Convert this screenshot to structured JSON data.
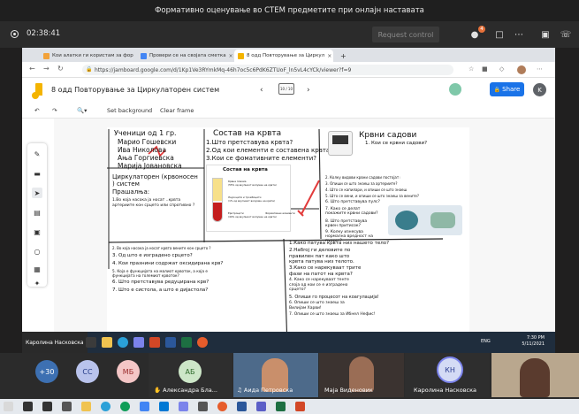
{
  "meeting": {
    "title": "Формативно оценување во СТЕМ предметите при онлајн наставата",
    "timer": "02:38:41",
    "request_control": "Request control",
    "participants_badge": "4"
  },
  "browser": {
    "tabs": [
      {
        "label": "Кои алатки ги користам за фор",
        "color": "#f2a23a"
      },
      {
        "label": "Провери се на својата сметка",
        "color": "#4285f4"
      },
      {
        "label": "8 одд Повторување за Циркул",
        "color": "#f4b400"
      }
    ],
    "url": "https://jamboard.google.com/d/1Kp1Ve3RYmkMq-46h7oc5c6PdK6ZTUoF_ln5vL4cYCk/viewer?f=9"
  },
  "jamboard": {
    "title": "8 одд Повторување за Циркулаторен систем",
    "share_label": "Share",
    "user_initial": "K",
    "frame_label": "10 / 10",
    "tools": {
      "set_background": "Set background",
      "clear_frame": "Clear frame"
    }
  },
  "board": {
    "students_header": "Ученици од 1 гр.",
    "students": [
      "Марио Гошевски",
      "Ива Николова",
      "Ања Горгиевска",
      "Марија Јовановска"
    ],
    "blood_title": "Состав на крвта",
    "blood_questions": [
      "1.Што претставува крвта?",
      "2.Од кои елементи е составена крвта?",
      "3.Кои се фомативните елементи?"
    ],
    "blood_diagram_title": "Состав на крвта",
    "blood_diagram_labels": [
      "Крвна плазма",
      "(55% од вкупниот волумен на крвта)",
      "Леукоцити и тромбоцити",
      "(1% од вкупниот волумен на крвта)",
      "Еритроцити",
      "(44% од вкупниот волумен на крвта)",
      "Формативни елементи"
    ],
    "vessels_title": "Крвни садови",
    "vessels_q1": "1. Кои се крвни садови?",
    "circ_title": "Циркулаторен (крвоносен ) систем",
    "circ_sub": "Прашалња:",
    "circ_text": "1.Во која насока ја носат ..крвта артериите кон срцето или спротивно ?",
    "vessel_questions": [
      "2. Колку видови крвни садови постојат во нашето тело, и кој се тие?",
      "3. Опиши се што знаеш за артериите?",
      "4. Што се капилари, и опиши се што знаеш за капилариите?",
      "5. Што се вени, и опиши се што знаеш за вените?",
      "6. Што претставува пулс?",
      "7. Како се делат покажите крвни садови?",
      "8. Што претставува крвен притисок?",
      "9. Колку изнесува нормална вредност на пулсот?"
    ],
    "heart_questions": [
      "2. Во која насока ја носат крвта вените кон срцето ?",
      "3. Од што е изградено срцето?",
      "4. Кои празнини содржат оксидирана крв?",
      "5. Која е функцијата на малиот крвоток, а која е функцијата на големиот крвоток?",
      "6. Што претставува редуцирана крв?",
      "7. Што е систола, а што е дијастола?"
    ],
    "path_questions": [
      "1.Како патува крвта низ нашето тело?",
      "2.Набroj ги деловите по правилен пат како што крвта патува низ телото.",
      "3.Како се нарекуваат трите фази на патот на крвта?",
      "4. Како се нарекуваат тенте слоја од кои се е изградено срцето?",
      "5. Опиши го процесот на коагулација!",
      "6. Опиши се што знаеш за Вилијам Харви!",
      "7. Опиши се што знаеш за Ибнел Нефис!"
    ]
  },
  "shared_taskbar": {
    "presenter": "Каролина Насковска",
    "lang": "ENG",
    "time": "7:30 PM",
    "date": "5/11/2021"
  },
  "participants": [
    {
      "initials": "+30",
      "color": "#3d70b2",
      "text_color": "#ffffff"
    },
    {
      "initials": "СС",
      "color": "#b9c3ec",
      "text_color": "#243a87"
    },
    {
      "initials": "МБ",
      "color": "#f4c6c6",
      "text_color": "#9b2c2c"
    },
    {
      "initials": "АБ",
      "color": "#cde7c8",
      "text_color": "#2f6b2b",
      "name": "Александра Бла..."
    },
    {
      "name": "Аида Петровска"
    },
    {
      "name": "Маја Виденовик"
    },
    {
      "initials": "КН",
      "color": "#d4dbf5",
      "text_color": "#2c3e91",
      "name": "Каролина Насковска"
    }
  ]
}
